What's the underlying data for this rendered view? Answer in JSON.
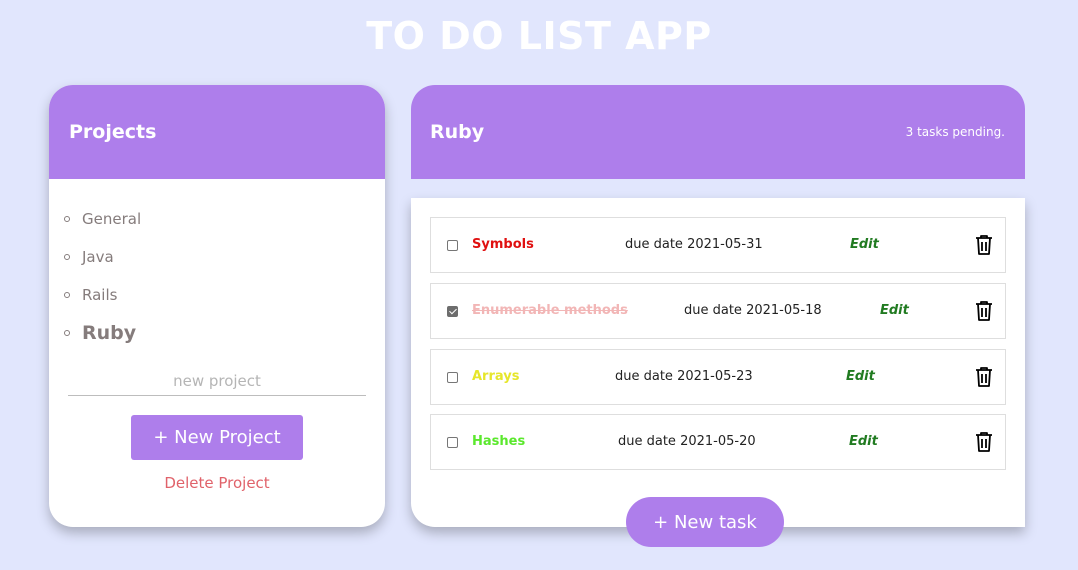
{
  "app": {
    "title": "TO DO LIST APP"
  },
  "projects": {
    "title": "Projects",
    "items": [
      {
        "label": "General",
        "active": false
      },
      {
        "label": "Java",
        "active": false
      },
      {
        "label": "Rails",
        "active": false
      },
      {
        "label": "Ruby",
        "active": true
      }
    ],
    "new_project_placeholder": "new project",
    "new_project_value": "",
    "new_project_button": "+ New Project",
    "delete_project_link": "Delete Project"
  },
  "tasks": {
    "project_name": "Ruby",
    "pending_text": "3 tasks pending.",
    "items": [
      {
        "title": "Symbols",
        "title_color": "#e01010",
        "done": false,
        "due": "due date 2021-05-31",
        "edit_label": "Edit"
      },
      {
        "title": "Enumerable methods",
        "title_color": "#f2b6b6",
        "done": true,
        "due": "due date 2021-05-18",
        "edit_label": "Edit"
      },
      {
        "title": "Arrays",
        "title_color": "#e6e62a",
        "done": false,
        "due": "due date 2021-05-23",
        "edit_label": "Edit"
      },
      {
        "title": "Hashes",
        "title_color": "#5be82d",
        "done": false,
        "due": "due date 2021-05-20",
        "edit_label": "Edit"
      }
    ],
    "new_task_button": "+ New task"
  },
  "colors": {
    "background": "#e1e6fd",
    "accent": "#ae7eeb",
    "edit": "#217b21",
    "delete_link": "#e0626a"
  },
  "icons": {
    "delete": "trash-icon"
  }
}
